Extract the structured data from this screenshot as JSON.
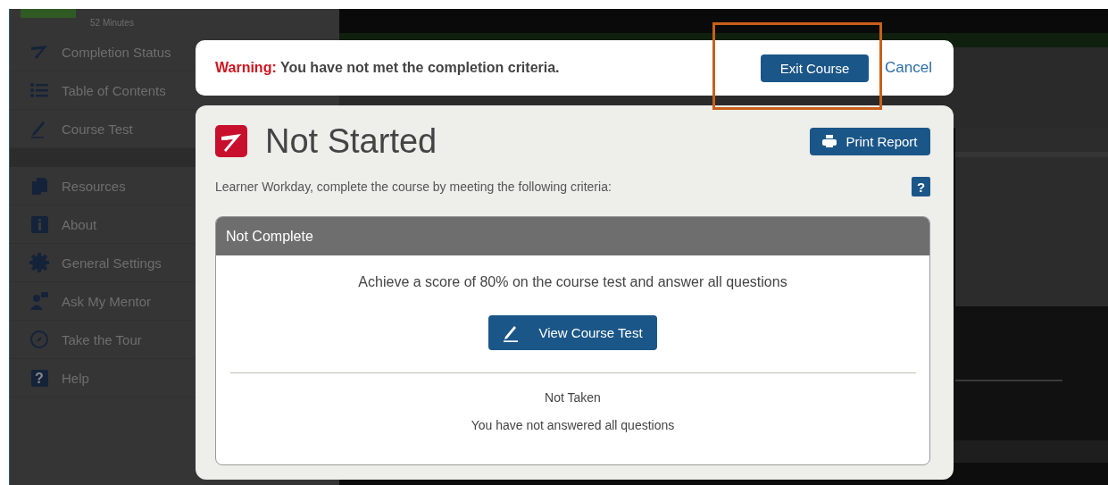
{
  "sidebar": {
    "duration": "52 Minutes",
    "groups": [
      [
        {
          "label": "Completion Status"
        },
        {
          "label": "Table of Contents"
        },
        {
          "label": "Course Test"
        }
      ],
      [
        {
          "label": "Resources"
        },
        {
          "label": "About"
        },
        {
          "label": "General Settings"
        },
        {
          "label": "Ask My Mentor"
        },
        {
          "label": "Take the Tour"
        },
        {
          "label": "Help",
          "icon_glyph": "?"
        }
      ]
    ]
  },
  "warning": {
    "text": "**Warning:** You have not met the completion criteria.",
    "exit_button": "Exit Course",
    "cancel_link": "Cancel"
  },
  "status_card": {
    "title": "Not Started",
    "print_button": "Print Report",
    "intro": "Learner Workday, complete the course by meeting the following criteria:",
    "help_icon": "?",
    "criteria": {
      "header": "Not Complete",
      "requirement": "Achieve a score of 80% on the course test and answer all questions",
      "test_button": "View Course Test",
      "result": "Not Taken",
      "note": "You have not answered all questions"
    }
  }
}
